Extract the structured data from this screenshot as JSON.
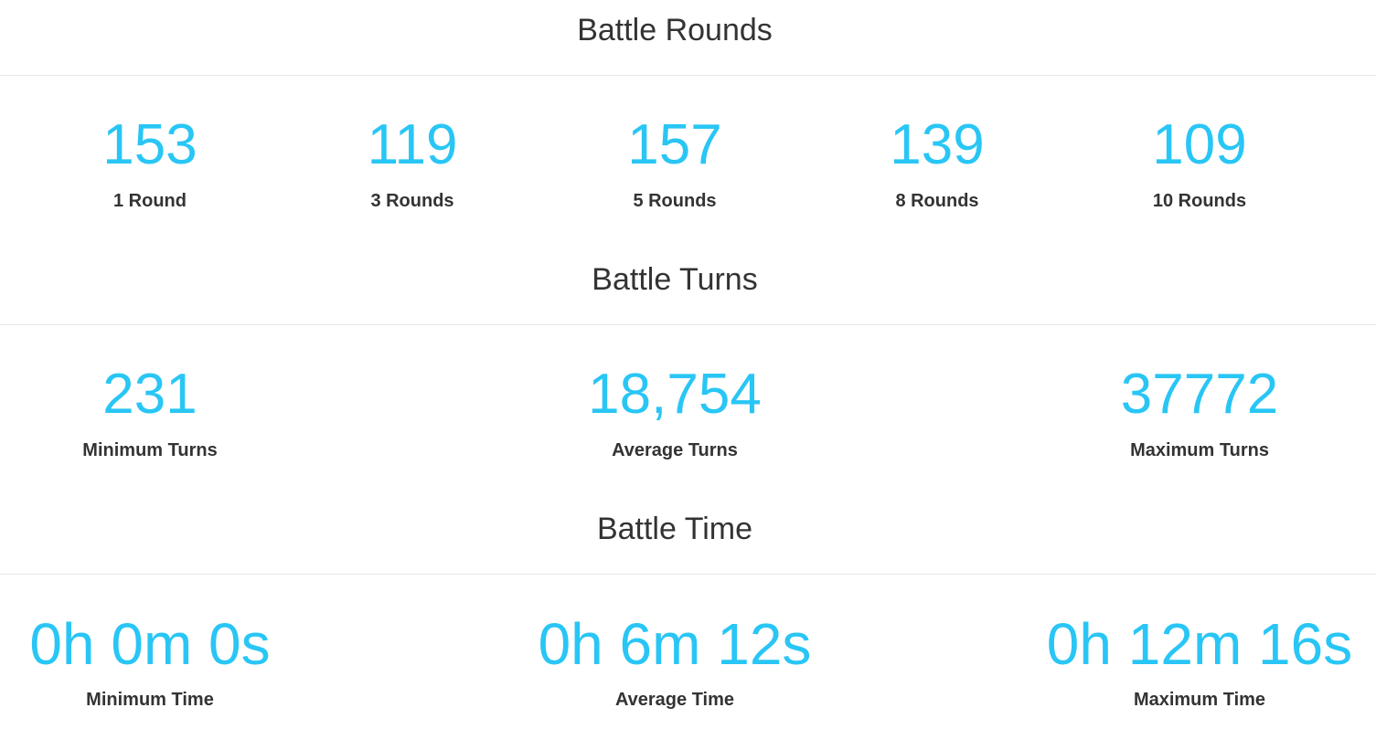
{
  "sections": [
    {
      "title": "Battle Rounds",
      "stats": [
        {
          "value": "153",
          "label": "1 Round"
        },
        {
          "value": "119",
          "label": "3 Rounds"
        },
        {
          "value": "157",
          "label": "5 Rounds"
        },
        {
          "value": "139",
          "label": "8 Rounds"
        },
        {
          "value": "109",
          "label": "10 Rounds"
        }
      ]
    },
    {
      "title": "Battle Turns",
      "stats": [
        {
          "value": "231",
          "label": "Minimum Turns"
        },
        {
          "value": "18,754",
          "label": "Average Turns"
        },
        {
          "value": "37772",
          "label": "Maximum Turns"
        }
      ]
    },
    {
      "title": "Battle Time",
      "stats": [
        {
          "value": "0h 0m 0s",
          "label": "Minimum Time"
        },
        {
          "value": "0h 6m 12s",
          "label": "Average Time"
        },
        {
          "value": "0h 12m 16s",
          "label": "Maximum Time"
        }
      ]
    }
  ],
  "colors": {
    "accent": "#29c6f5",
    "text": "#333333",
    "divider": "#e6e6e6"
  }
}
